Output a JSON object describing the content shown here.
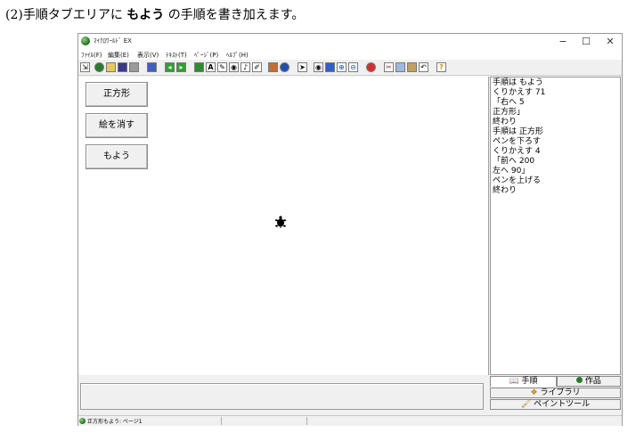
{
  "caption": {
    "prefix": "(2)手順タブエリアに ",
    "keyword": "もよう",
    "suffix": " の手順を書き加えます。"
  },
  "window": {
    "title": "ﾏｲｸﾛﾜｰﾙﾄﾞ EX",
    "controls": {
      "minimize": "−",
      "maximize": "☐",
      "close": "✕"
    }
  },
  "menu": [
    "ﾌｧｲﾙ(F)",
    "編集(E)",
    "表示(V)",
    "ﾃｷｽﾄ(T)",
    "ﾍﾟｰｼﾞ(P)",
    "ﾍﾙﾌﾟ(H)"
  ],
  "toolbar_icons": [
    "pin-icon",
    "globe-icon",
    "open-folder-icon",
    "save-icon",
    "print-icon",
    "list-icon",
    "back-arrow-icon",
    "forward-arrow-icon",
    "turtle-icon",
    "text-box-icon",
    "pencil-icon",
    "eye-icon",
    "music-icon",
    "paint-icon",
    "sprite-icon",
    "world-icon",
    "cursor-icon",
    "view-icon",
    "stamp-icon",
    "zoom-in-icon",
    "zoom-out-icon",
    "stop-icon",
    "scissors-icon",
    "copy-icon",
    "paste-icon",
    "undo-icon",
    "help-icon"
  ],
  "side_buttons": [
    "正方形",
    "絵を消す",
    "もよう"
  ],
  "procedure_lines": [
    "手順は もよう",
    "くりかえす 71",
    "「右へ 5",
    "正方形」",
    "終わり",
    "手順は 正方形",
    "ペンを下ろす",
    "くりかえす 4",
    "「前へ 200",
    "左へ 90」",
    "ペンを上げる",
    "終わり"
  ],
  "tabs": {
    "procedure": "手順",
    "works": "作品",
    "library": "ライブラリ",
    "paint": "ペイントツール"
  },
  "status": {
    "text": "正方形もよう: ページ1"
  },
  "colors": {
    "turtle": "#000000",
    "globe": "#2b7a2b"
  }
}
